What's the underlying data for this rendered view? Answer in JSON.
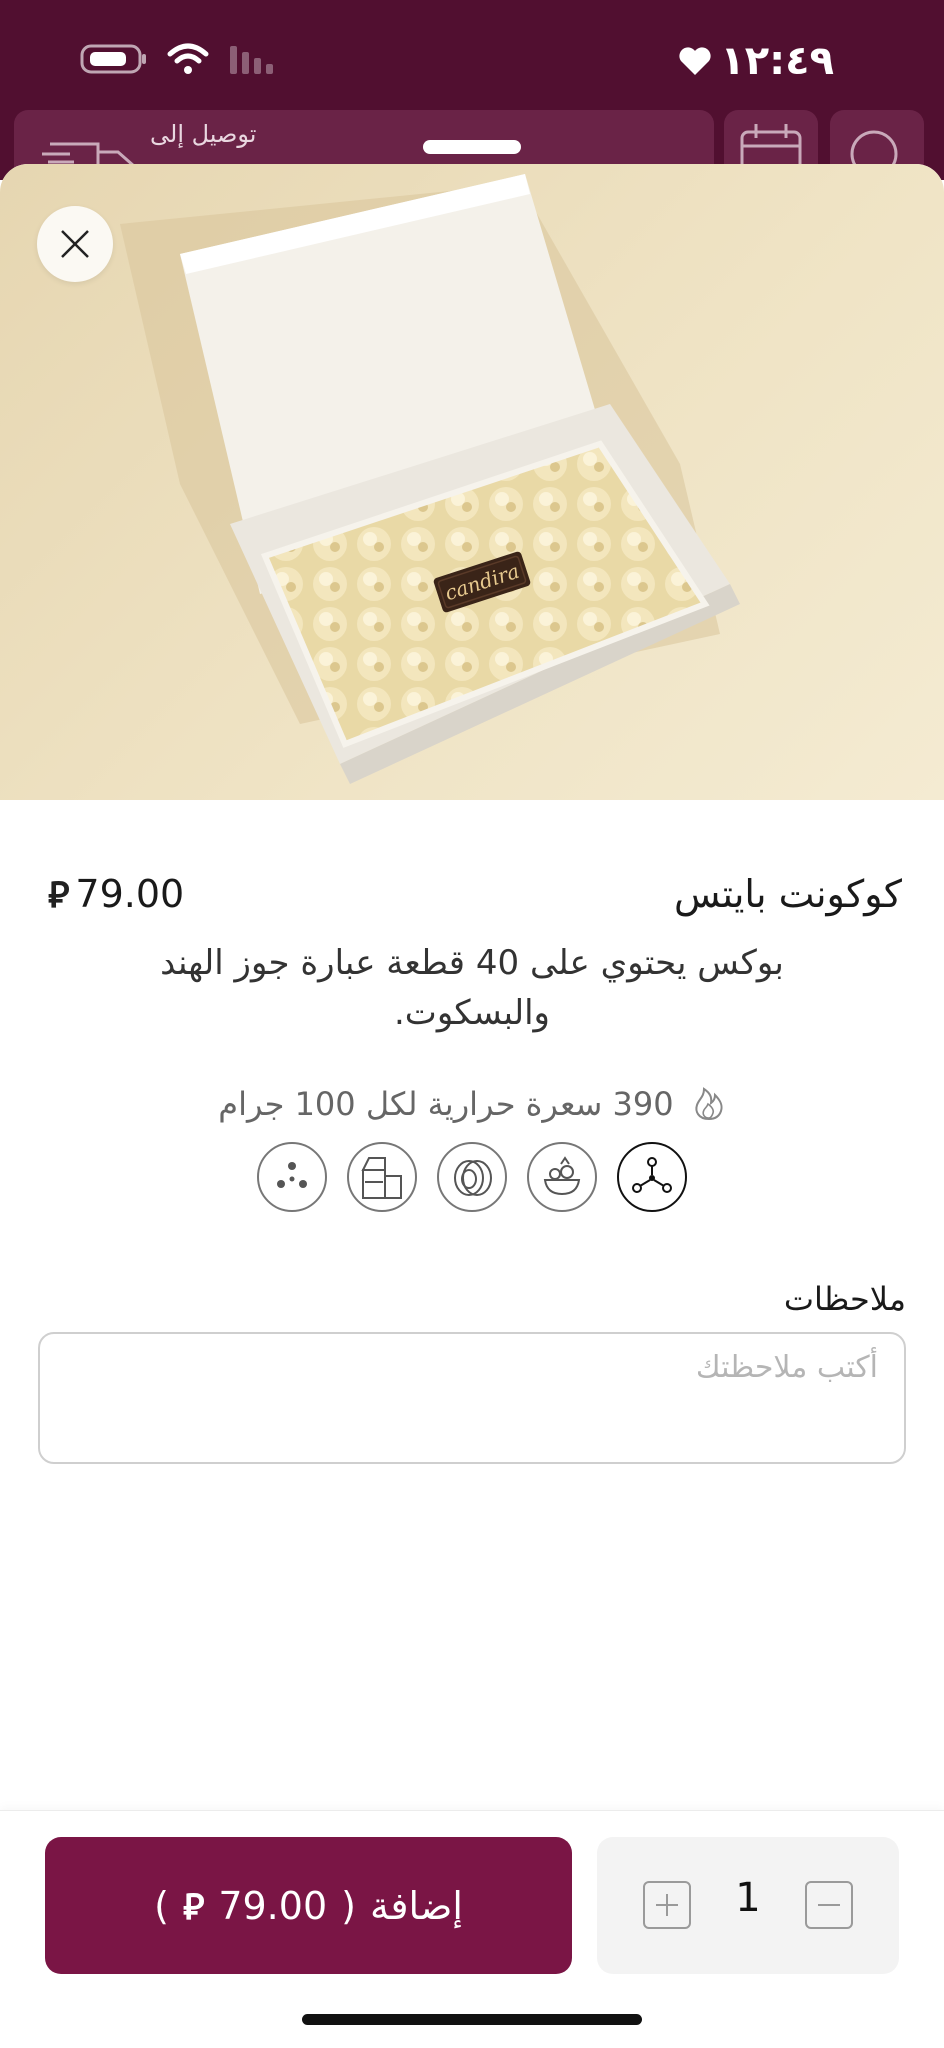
{
  "status_bar": {
    "time": "١٢:٤٩"
  },
  "header": {
    "delivery_label": "توصيل إلى"
  },
  "product": {
    "title": "كوكونت بايتس",
    "price": "79.00",
    "currency_symbol": "⃁",
    "description": "بوكس يحتوي على 40 قطعة عبارة جوز الهند والبسكوت.",
    "calories": "390 سعرة حرارية لكل 100 جرام",
    "image_brand": "candira",
    "allergens": [
      {
        "icon": "molecule-icon",
        "selected": true
      },
      {
        "icon": "wheat-bowl-icon",
        "selected": false
      },
      {
        "icon": "egg-icon",
        "selected": false
      },
      {
        "icon": "milk-icon",
        "selected": false
      },
      {
        "icon": "sesame-icon",
        "selected": false
      }
    ]
  },
  "notes": {
    "label": "ملاحظات",
    "placeholder": "أكتب ملاحظتك",
    "value": ""
  },
  "cart": {
    "add_label": "إضافة",
    "open_paren": "(",
    "close_paren": ")",
    "price": "79.00",
    "quantity": "1"
  },
  "colors": {
    "brand": "#7a1545",
    "header": "#510f30"
  }
}
